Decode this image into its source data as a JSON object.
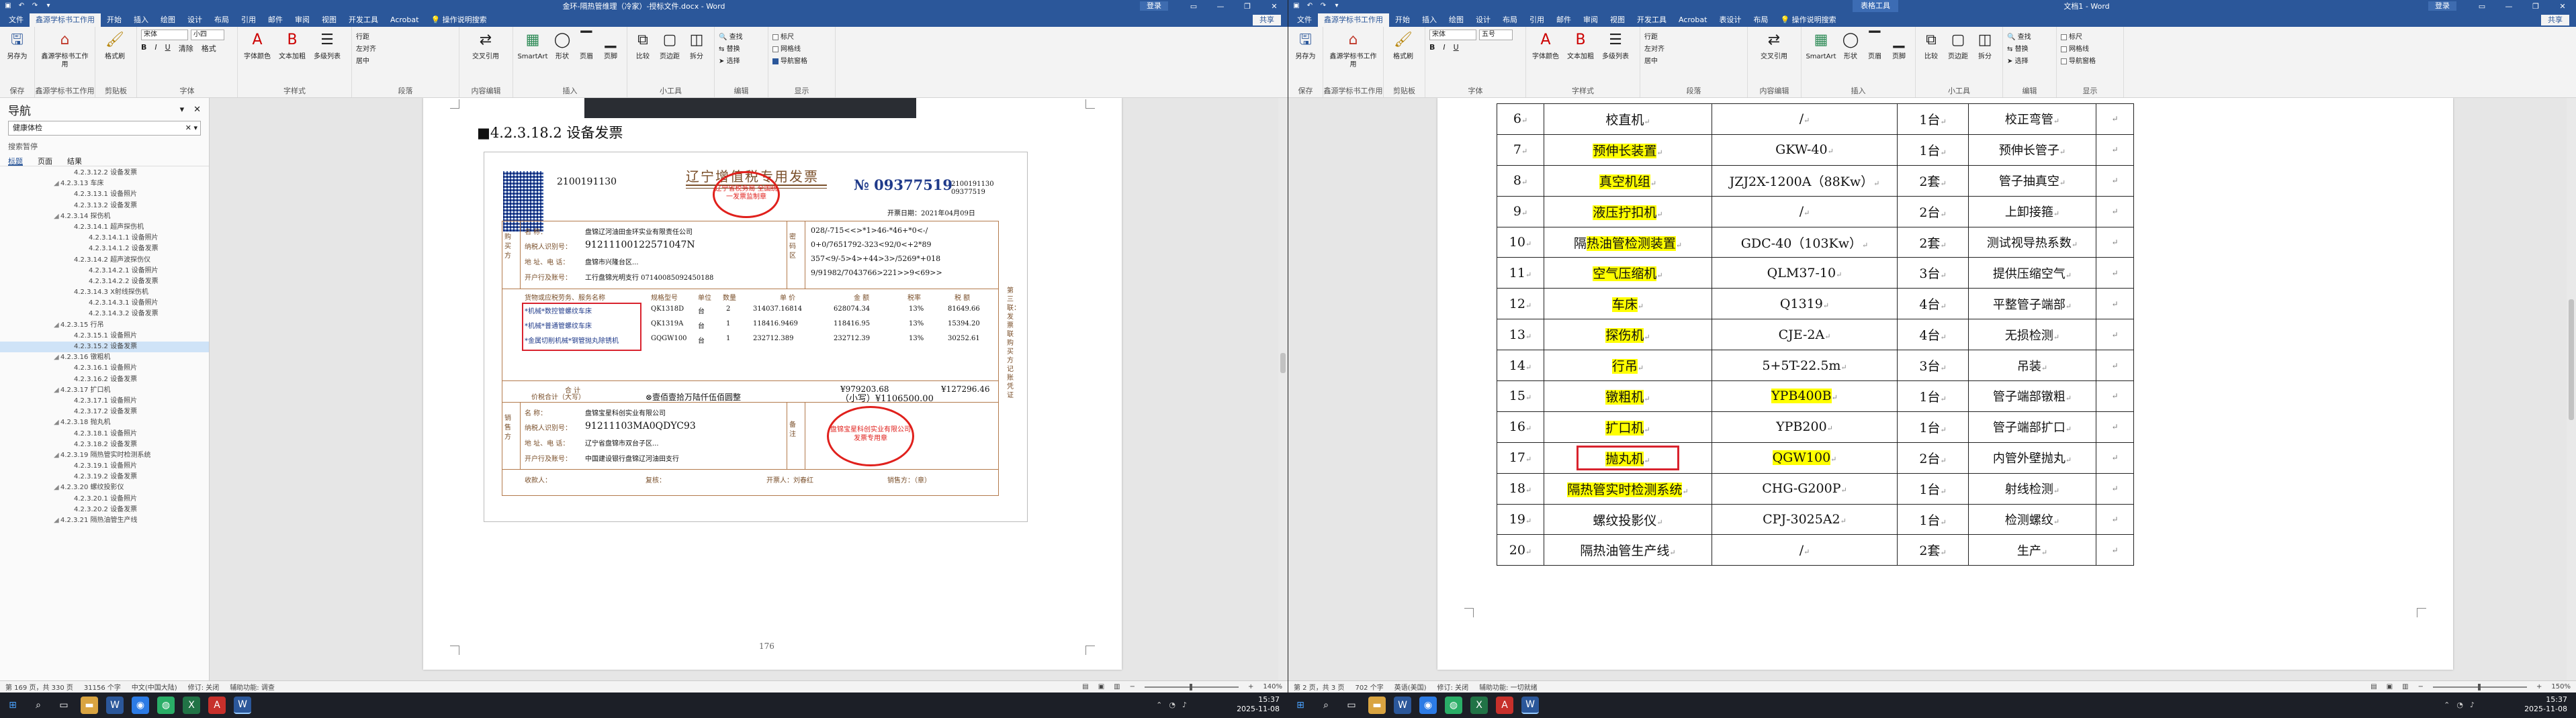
{
  "colors": {
    "accent": "#2b579a",
    "highlight": "#ffff00",
    "red_box": "#d9232e",
    "stamp": "#e0201c"
  },
  "window_left": {
    "title": "金环-隔热管维理（冷家）-授标文件.docx - Word",
    "login": "登录",
    "tabs": [
      "文件",
      "鑫源学标书工作用",
      "开始",
      "插入",
      "绘图",
      "设计",
      "布局",
      "引用",
      "邮件",
      "审阅",
      "视图",
      "开发工具",
      "Acrobat"
    ],
    "tell_me": "操作说明搜索",
    "share": "共享",
    "ribbon": {
      "g1": {
        "btn": "另存为",
        "label": "保存"
      },
      "g2": {
        "btn": "鑫源学标书工作用",
        "label": "鑫源学标书工作用"
      },
      "g3": {
        "btn": "格式刷",
        "label": "剪贴板"
      },
      "font_name": "宋体",
      "font_size": "小四",
      "g4": {
        "b1": "清除",
        "b2": "格式",
        "label": "字体"
      },
      "g5": {
        "b1": "字体颜色",
        "b2": "文本加粗",
        "b3": "多级列表",
        "label": "字样式"
      },
      "g6": {
        "items": [
          "行距",
          "左对齐",
          "居中"
        ],
        "label": "段落"
      },
      "g7": {
        "b1": "交叉引用",
        "label": "内容编辑"
      },
      "g8": {
        "b1": "SmartArt",
        "b2": "形状",
        "b3": "页眉",
        "b4": "页脚",
        "label": "插入"
      },
      "g9": {
        "b1": "比较",
        "b2": "页边距",
        "b3": "拆分",
        "label": "小工具"
      },
      "g10": {
        "items": [
          "查找",
          "替换",
          "选择"
        ],
        "label": "编辑"
      },
      "g11": {
        "items": [
          "标尺",
          "网格线",
          "导航窗格"
        ],
        "label": "显示"
      }
    },
    "nav": {
      "title": "导航",
      "search": "健康体检",
      "results": "搜索暂停",
      "tabs": [
        "标题",
        "页面",
        "结果"
      ],
      "tree": [
        {
          "t": "4.2.3.12.2 设备发票",
          "lv": "l3"
        },
        {
          "t": "4.2.3.13 车床",
          "lv": "l2"
        },
        {
          "t": "4.2.3.13.1 设备照片",
          "lv": "l3"
        },
        {
          "t": "4.2.3.13.2 设备发票",
          "lv": "l3"
        },
        {
          "t": "4.2.3.14 探伤机",
          "lv": "l2"
        },
        {
          "t": "4.2.3.14.1 超声探伤机",
          "lv": "l3"
        },
        {
          "t": "4.2.3.14.1.1 设备照片",
          "lv": "l4"
        },
        {
          "t": "4.2.3.14.1.2 设备发票",
          "lv": "l4"
        },
        {
          "t": "4.2.3.14.2 超声波探伤仪",
          "lv": "l3"
        },
        {
          "t": "4.2.3.14.2.1 设备照片",
          "lv": "l4"
        },
        {
          "t": "4.2.3.14.2.2 设备发票",
          "lv": "l4"
        },
        {
          "t": "4.2.3.14.3 X射线探伤机",
          "lv": "l3"
        },
        {
          "t": "4.2.3.14.3.1 设备照片",
          "lv": "l4"
        },
        {
          "t": "4.2.3.14.3.2 设备发票",
          "lv": "l4"
        },
        {
          "t": "4.2.3.15 行吊",
          "lv": "l2"
        },
        {
          "t": "4.2.3.15.1 设备照片",
          "lv": "l3"
        },
        {
          "t": "4.2.3.15.2 设备发票",
          "lv": "l3",
          "cur": true
        },
        {
          "t": "4.2.3.16 镦粗机",
          "lv": "l2"
        },
        {
          "t": "4.2.3.16.1 设备照片",
          "lv": "l3"
        },
        {
          "t": "4.2.3.16.2 设备发票",
          "lv": "l3"
        },
        {
          "t": "4.2.3.17 扩口机",
          "lv": "l2"
        },
        {
          "t": "4.2.3.17.1 设备照片",
          "lv": "l3"
        },
        {
          "t": "4.2.3.17.2 设备发票",
          "lv": "l3"
        },
        {
          "t": "4.2.3.18 抛丸机",
          "lv": "l2"
        },
        {
          "t": "4.2.3.18.1 设备照片",
          "lv": "l3"
        },
        {
          "t": "4.2.3.18.2 设备发票",
          "lv": "l3"
        },
        {
          "t": "4.2.3.19 隔热管实时检测系统",
          "lv": "l2"
        },
        {
          "t": "4.2.3.19.1 设备照片",
          "lv": "l3"
        },
        {
          "t": "4.2.3.19.2 设备发票",
          "lv": "l3"
        },
        {
          "t": "4.2.3.20 螺纹投影仪",
          "lv": "l2"
        },
        {
          "t": "4.2.3.20.1 设备照片",
          "lv": "l3"
        },
        {
          "t": "4.2.3.20.2 设备发票",
          "lv": "l3"
        },
        {
          "t": "4.2.3.21 隔热油管生产线",
          "lv": "l2"
        }
      ]
    },
    "doc": {
      "heading": "4.2.3.18.2 设备发票",
      "page_number": "176",
      "invoice": {
        "code": "2100191130",
        "title": "辽宁增值税专用发票",
        "no_prefix": "№",
        "no": "09377519",
        "no_side": "2100191130 09377519",
        "date": "开票日期：2021年04月09日",
        "buyer_label": "购买方",
        "buyer_rows": [
          "名 称：",
          "纳税人识别号：",
          "地 址、电 话：",
          "开户行及账号："
        ],
        "buyer_vals": [
          "盘锦辽河油田金环实业有限责任公司",
          "91211100122571047N",
          "盘锦市兴隆台区...",
          "工行盘锦光明支行 07140085092450188"
        ],
        "pwd_label": "密码区",
        "pwd": [
          "028/-715<<>*1>46-*46+*0<-/",
          "0+0/7651792-323<92/0<+2*89",
          "357<9/-5>4>+44>3>/5269*+018",
          "9/91982/7043766>221>>9<69>>"
        ],
        "cols": [
          "货物或应税劳务、服务名称",
          "规格型号",
          "单位",
          "数量",
          "单 价",
          "金 额",
          "税率",
          "税 额"
        ],
        "items": [
          [
            "*机械*数控管螺纹车床",
            "QK1318D",
            "台",
            "2",
            "314037.16814",
            "628074.34",
            "13%",
            "81649.66"
          ],
          [
            "*机械*普通管螺纹车床",
            "QK1319A",
            "台",
            "1",
            "118416.9469",
            "118416.95",
            "13%",
            "15394.20"
          ],
          [
            "*金属切削机械*钢管抛丸除锈机",
            "GQGW100",
            "台",
            "1",
            "232712.389",
            "232712.39",
            "13%",
            "30252.61"
          ]
        ],
        "total_label": "合 计",
        "total_amount": "¥979203.68",
        "total_tax": "¥127296.46",
        "sum_label": "价税合计（大写）",
        "sum_words": "⊗壹佰壹拾万陆仟伍佰圆整",
        "sum_small": "（小写）¥1106500.00",
        "seller_label": "销售方",
        "seller_rows": [
          "名 称：",
          "纳税人识别号：",
          "地 址、电 话：",
          "开户行及账号："
        ],
        "seller_vals": [
          "盘锦宝星科创实业有限公司",
          "91211103MA0QDYC93",
          "辽宁省盘锦市双台子区...",
          "中国建设银行盘锦辽河油田支行"
        ],
        "remark_label": "备注",
        "payee": "收款人：",
        "checker": "复核：",
        "drawer": "开票人：刘春红",
        "seller_seal": "销售方：（章）",
        "stamp1": "辽宁省税务局 全国统一发票监制章",
        "stamp2": "盘锦宝星科创实业有限公司 发票专用章",
        "side": "第三联：发票联 购买方记账凭证"
      }
    },
    "status": {
      "page": "第 169 页，共 330 页",
      "words": "31156 个字",
      "lang": "中文(中国大陆)",
      "track": "修订: 关闭",
      "access": "辅助功能: 调查",
      "zoom": "140%"
    }
  },
  "window_right": {
    "title": "文档1 - Word",
    "context_tab": "表格工具",
    "login": "登录",
    "tabs": [
      "文件",
      "鑫源学标书工作用",
      "开始",
      "插入",
      "绘图",
      "设计",
      "布局",
      "引用",
      "邮件",
      "审阅",
      "视图",
      "开发工具",
      "Acrobat",
      "表设计",
      "布局"
    ],
    "tell_me": "操作说明搜索",
    "share": "共享",
    "font_name": "宋体",
    "font_size": "五号",
    "status": {
      "page": "第 2 页，共 3 页",
      "words": "702 个字",
      "lang": "英语(美国)",
      "track": "修订: 关闭",
      "access": "辅助功能: 一切就绪",
      "zoom": "150%"
    },
    "table": [
      [
        "6",
        "校直机",
        "/",
        "1台",
        "校正弯管"
      ],
      [
        "7",
        "预伸长装置",
        "GKW-40",
        "1台",
        "预伸长管子"
      ],
      [
        "8",
        "真空机组",
        "JZJ2X-1200A（88Kw）",
        "2套",
        "管子抽真空"
      ],
      [
        "9",
        "液压拧扣机",
        "/",
        "2台",
        "上卸接箍"
      ],
      [
        "10",
        "隔热油管检测装置",
        "GDC-40（103Kw）",
        "2套",
        "测试视导热系数"
      ],
      [
        "11",
        "空气压缩机",
        "QLM37-10",
        "3台",
        "提供压缩空气"
      ],
      [
        "12",
        "车床",
        "Q1319",
        "4台",
        "平整管子端部"
      ],
      [
        "13",
        "探伤机",
        "CJE-2A",
        "4台",
        "无损检测"
      ],
      [
        "14",
        "行吊",
        "5+5T-22.5m",
        "3台",
        "吊装"
      ],
      [
        "15",
        "镦粗机",
        "YPB400B",
        "1台",
        "管子端部镦粗"
      ],
      [
        "16",
        "扩口机",
        "YPB200",
        "1台",
        "管子端部扩口"
      ],
      [
        "17",
        "抛丸机",
        "QGW100",
        "2台",
        "内管外壁抛丸"
      ],
      [
        "18",
        "隔热管实时检测系统",
        "CHG-G200P",
        "1台",
        "射线检测"
      ],
      [
        "19",
        "螺纹投影仪",
        "CPJ-3025A2",
        "1台",
        "检测螺纹"
      ],
      [
        "20",
        "隔热油管生产线",
        "/",
        "2套",
        "生产"
      ]
    ]
  },
  "taskbar": {
    "time": "15:37",
    "date": "2025-11-08"
  }
}
